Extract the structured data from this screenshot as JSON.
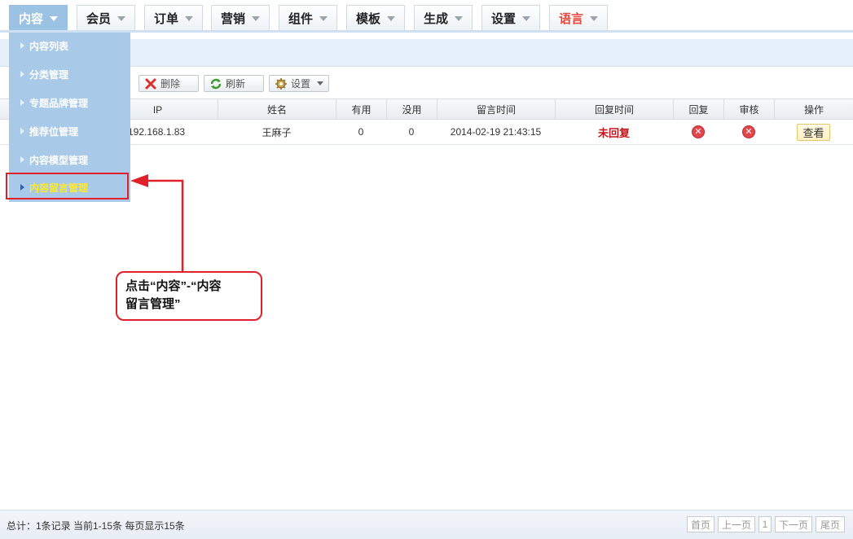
{
  "nav": {
    "items": [
      {
        "label": "内容",
        "active": true
      },
      {
        "label": "会员"
      },
      {
        "label": "订单"
      },
      {
        "label": "营销"
      },
      {
        "label": "组件"
      },
      {
        "label": "模板"
      },
      {
        "label": "生成"
      },
      {
        "label": "设置"
      },
      {
        "label": "语言",
        "highlight": true
      }
    ]
  },
  "dropdown": {
    "items": [
      {
        "label": "内容列表"
      },
      {
        "label": "分类管理"
      },
      {
        "label": "专题品牌管理"
      },
      {
        "label": "推荐位管理"
      },
      {
        "label": "内容模型管理"
      },
      {
        "label": "内容留言管理",
        "selected": true
      }
    ]
  },
  "toolbar": {
    "delete_label": "删除",
    "refresh_label": "刷新",
    "settings_label": "设置"
  },
  "table": {
    "headers": {
      "ip": "IP",
      "name": "姓名",
      "useful": "有用",
      "useless": "没用",
      "msg_time": "留言时间",
      "reply_time": "回复时间",
      "reply": "回复",
      "review": "审核",
      "action": "操作"
    },
    "rows": [
      {
        "ip": "192.168.1.83",
        "name": "王麻子",
        "useful": "0",
        "useless": "0",
        "msg_time": "2014-02-19 21:43:15",
        "reply_time": "未回复",
        "action": "查看"
      }
    ]
  },
  "annotation": {
    "line1": "点击“内容”-“内容",
    "line2": "留言管理”"
  },
  "footer": {
    "summary": "总计：1条记录 当前1-15条 每页显示15条",
    "first": "首页",
    "prev": "上一页",
    "page": "1",
    "next": "下一页",
    "last": "尾页"
  },
  "colors": {
    "accent": "#9cc2e3",
    "dropdown_bg": "#a9c9e8",
    "annotation": "#e0202a",
    "unreplied": "#c4141a"
  }
}
